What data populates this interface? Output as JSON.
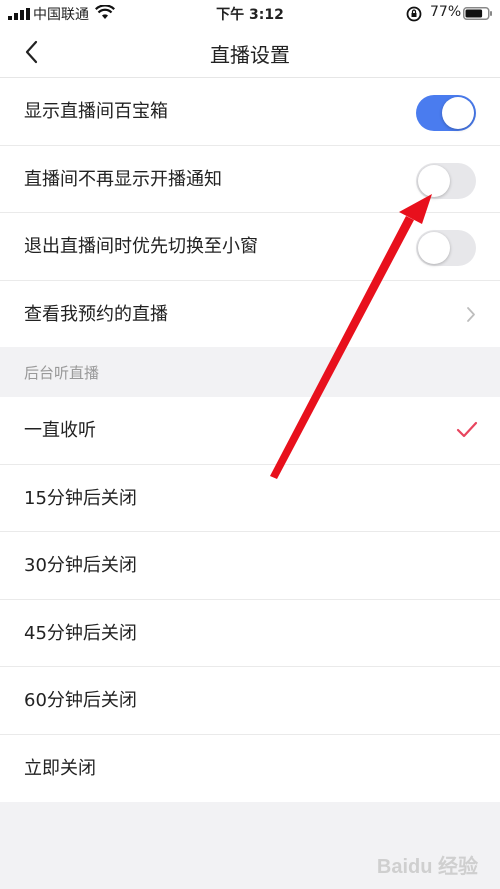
{
  "status_bar": {
    "carrier": "中国联通",
    "time": "下午 3:12",
    "battery_percent": "77%",
    "battery_level": 0.77
  },
  "nav": {
    "title": "直播设置"
  },
  "settings": [
    {
      "label": "显示直播间百宝箱",
      "control": "toggle",
      "on": true
    },
    {
      "label": "直播间不再显示开播通知",
      "control": "toggle",
      "on": false
    },
    {
      "label": "退出直播间时优先切换至小窗",
      "control": "toggle",
      "on": false
    },
    {
      "label": "查看我预约的直播",
      "control": "chevron"
    }
  ],
  "background_listen": {
    "header": "后台听直播",
    "options": [
      {
        "label": "一直收听",
        "selected": true
      },
      {
        "label": "15分钟后关闭",
        "selected": false
      },
      {
        "label": "30分钟后关闭",
        "selected": false
      },
      {
        "label": "45分钟后关闭",
        "selected": false
      },
      {
        "label": "60分钟后关闭",
        "selected": false
      },
      {
        "label": "立即关闭",
        "selected": false
      }
    ]
  },
  "colors": {
    "toggle_on": "#4a7cef",
    "toggle_off": "#e7e7ea",
    "checkmark": "#e8455e",
    "annotation_arrow": "#e8101c"
  },
  "watermark": "Baidu 经验"
}
